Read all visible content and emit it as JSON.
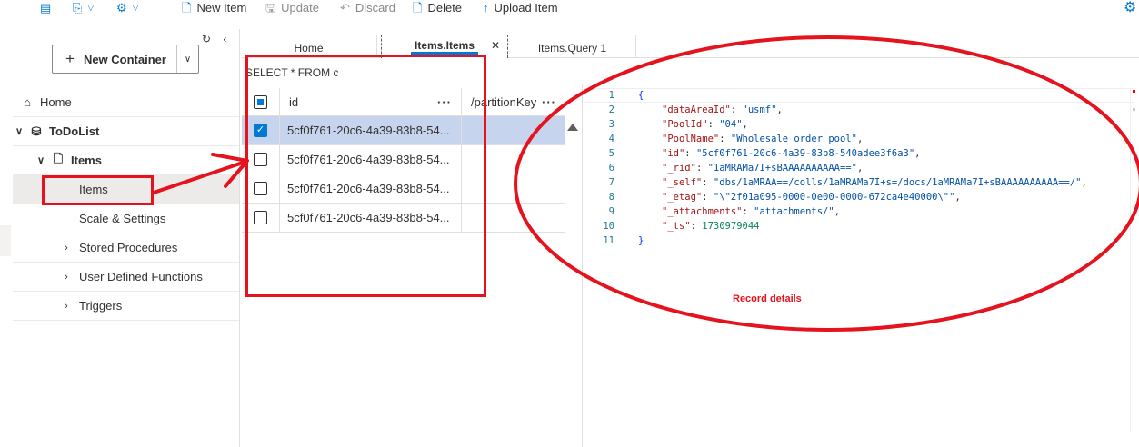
{
  "toolbar": {
    "new_item": "New Item",
    "update": "Update",
    "discard": "Discard",
    "delete": "Delete",
    "upload_item": "Upload Item"
  },
  "sidebar": {
    "new_container": "New Container",
    "tree": [
      {
        "label": "Home",
        "icon": "home-icon"
      },
      {
        "label": "ToDoList",
        "icon": "database-icon"
      },
      {
        "label": "Items",
        "icon": "document-icon"
      },
      {
        "label": "Items"
      },
      {
        "label": "Scale & Settings"
      },
      {
        "label": "Stored Procedures"
      },
      {
        "label": "User Defined Functions"
      },
      {
        "label": "Triggers"
      }
    ]
  },
  "tabs": [
    {
      "label": "Home"
    },
    {
      "label": "Items.Items",
      "active": true
    },
    {
      "label": "Items.Query 1"
    }
  ],
  "query": "SELECT * FROM c",
  "grid": {
    "columns": [
      "id",
      "/partitionKey"
    ],
    "rows": [
      {
        "id": "5cf0f761-20c6-4a39-83b8-54...",
        "checked": true
      },
      {
        "id": "5cf0f761-20c6-4a39-83b8-54...",
        "checked": false
      },
      {
        "id": "5cf0f761-20c6-4a39-83b8-54...",
        "checked": false
      },
      {
        "id": "5cf0f761-20c6-4a39-83b8-54...",
        "checked": false
      }
    ]
  },
  "editor": {
    "line_numbers": [
      "1",
      "2",
      "3",
      "4",
      "5",
      "6",
      "7",
      "8",
      "9",
      "10",
      "11"
    ],
    "document": {
      "open": "{",
      "close": "}",
      "fields": [
        {
          "key": "\"dataAreaId\"",
          "value": "\"usmf\"",
          "comma": ","
        },
        {
          "key": "\"PoolId\"",
          "value": "\"04\"",
          "comma": ","
        },
        {
          "key": "\"PoolName\"",
          "value": "\"Wholesale order pool\"",
          "comma": ","
        },
        {
          "key": "\"id\"",
          "value": "\"5cf0f761-20c6-4a39-83b8-540adee3f6a3\"",
          "comma": ","
        },
        {
          "key": "\"_rid\"",
          "value": "\"1aMRAMa7I+sBAAAAAAAAAA==\"",
          "comma": ","
        },
        {
          "key": "\"_self\"",
          "value": "\"dbs/1aMRAA==/colls/1aMRAMa7I+s=/docs/1aMRAMa7I+sBAAAAAAAAAA==/\"",
          "comma": ","
        },
        {
          "key": "\"_etag\"",
          "value": "\"\\\"2f01a095-0000-0e00-0000-672ca4e40000\\\"\"",
          "comma": ","
        },
        {
          "key": "\"_attachments\"",
          "value": "\"attachments/\"",
          "comma": ","
        },
        {
          "key": "\"_ts\"",
          "value": "1730979044",
          "comma": ""
        }
      ]
    }
  },
  "annotation": {
    "label": "Record details",
    "color": "#e5131d"
  },
  "colors": {
    "accent": "#0078d4",
    "selected_row": "#c7d4ee"
  }
}
